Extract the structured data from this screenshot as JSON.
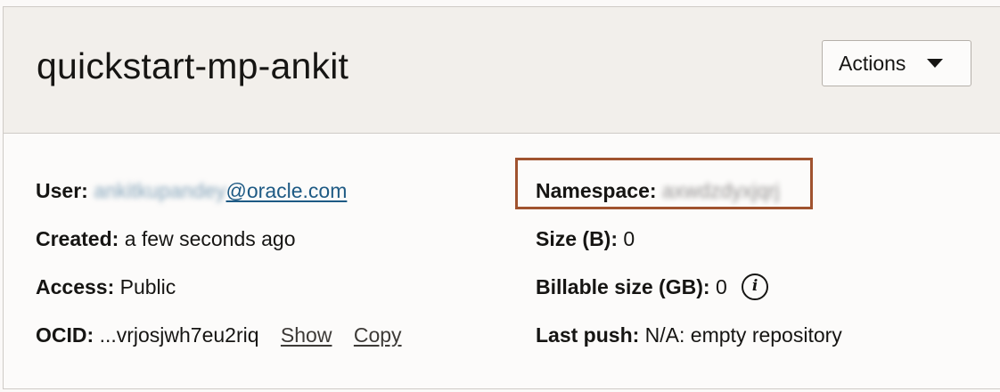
{
  "header": {
    "title": "quickstart-mp-ankit",
    "actions_label": "Actions"
  },
  "details_left": {
    "user": {
      "label": "User:",
      "value_obscured": "ankitkupandey",
      "value_visible": "@oracle.com"
    },
    "created": {
      "label": "Created:",
      "value": "a few seconds ago"
    },
    "access": {
      "label": "Access:",
      "value": "Public"
    },
    "ocid": {
      "label": "OCID:",
      "value": "...vrjosjwh7eu2riq",
      "show_label": "Show",
      "copy_label": "Copy"
    }
  },
  "details_right": {
    "namespace": {
      "label": "Namespace:",
      "value_obscured": "axwdzdyxjqrj"
    },
    "size": {
      "label": "Size (B):",
      "value": "0"
    },
    "billable": {
      "label": "Billable size (GB):",
      "value": "0",
      "info_glyph": "i"
    },
    "last_push": {
      "label": "Last push:",
      "value": "N/A: empty repository"
    }
  },
  "colors": {
    "header_bg": "#f2efeb",
    "link_blue": "#1e5a84",
    "highlight_border": "#a0532f"
  },
  "icons": {
    "actions_caret": "caret-down-icon",
    "billable_info": "info-icon"
  }
}
